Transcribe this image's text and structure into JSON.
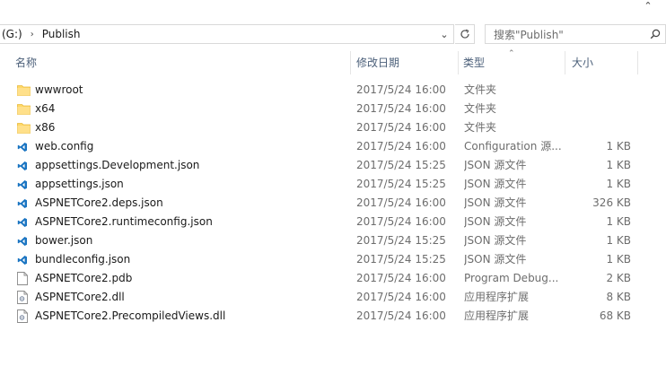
{
  "window": {
    "top_chevron": "⌃"
  },
  "address": {
    "drive": "(G:)",
    "separator": "›",
    "folder": "Publish",
    "dropdown": "⌄"
  },
  "search": {
    "placeholder": "搜索\"Publish\""
  },
  "columns": {
    "name": "名称",
    "date": "修改日期",
    "type": "类型",
    "size": "大小",
    "sort_indicator": "⌃"
  },
  "files": [
    {
      "icon": "folder-icon",
      "name": "wwwroot",
      "date": "2017/5/24 16:00",
      "type": "文件夹",
      "size": ""
    },
    {
      "icon": "folder-icon",
      "name": "x64",
      "date": "2017/5/24 16:00",
      "type": "文件夹",
      "size": ""
    },
    {
      "icon": "folder-icon",
      "name": "x86",
      "date": "2017/5/24 16:00",
      "type": "文件夹",
      "size": ""
    },
    {
      "icon": "vscode-file-icon",
      "name": "web.config",
      "date": "2017/5/24 16:00",
      "type": "Configuration 源...",
      "size": "1 KB"
    },
    {
      "icon": "vscode-file-icon",
      "name": "appsettings.Development.json",
      "date": "2017/5/24 15:25",
      "type": "JSON 源文件",
      "size": "1 KB"
    },
    {
      "icon": "vscode-file-icon",
      "name": "appsettings.json",
      "date": "2017/5/24 15:25",
      "type": "JSON 源文件",
      "size": "1 KB"
    },
    {
      "icon": "vscode-file-icon",
      "name": "ASPNETCore2.deps.json",
      "date": "2017/5/24 16:00",
      "type": "JSON 源文件",
      "size": "326 KB"
    },
    {
      "icon": "vscode-file-icon",
      "name": "ASPNETCore2.runtimeconfig.json",
      "date": "2017/5/24 16:00",
      "type": "JSON 源文件",
      "size": "1 KB"
    },
    {
      "icon": "vscode-file-icon",
      "name": "bower.json",
      "date": "2017/5/24 15:25",
      "type": "JSON 源文件",
      "size": "1 KB"
    },
    {
      "icon": "vscode-file-icon",
      "name": "bundleconfig.json",
      "date": "2017/5/24 15:25",
      "type": "JSON 源文件",
      "size": "1 KB"
    },
    {
      "icon": "blank-file-icon",
      "name": "ASPNETCore2.pdb",
      "date": "2017/5/24 16:00",
      "type": "Program Debug...",
      "size": "2 KB"
    },
    {
      "icon": "dll-file-icon",
      "name": "ASPNETCore2.dll",
      "date": "2017/5/24 16:00",
      "type": "应用程序扩展",
      "size": "8 KB"
    },
    {
      "icon": "dll-file-icon",
      "name": "ASPNETCore2.PrecompiledViews.dll",
      "date": "2017/5/24 16:00",
      "type": "应用程序扩展",
      "size": "68 KB"
    }
  ],
  "colors": {
    "folder": "#ffd867",
    "vscode_blue": "#1b75c2",
    "header_text": "#4c607a",
    "meta_text": "#6d6d6d"
  }
}
